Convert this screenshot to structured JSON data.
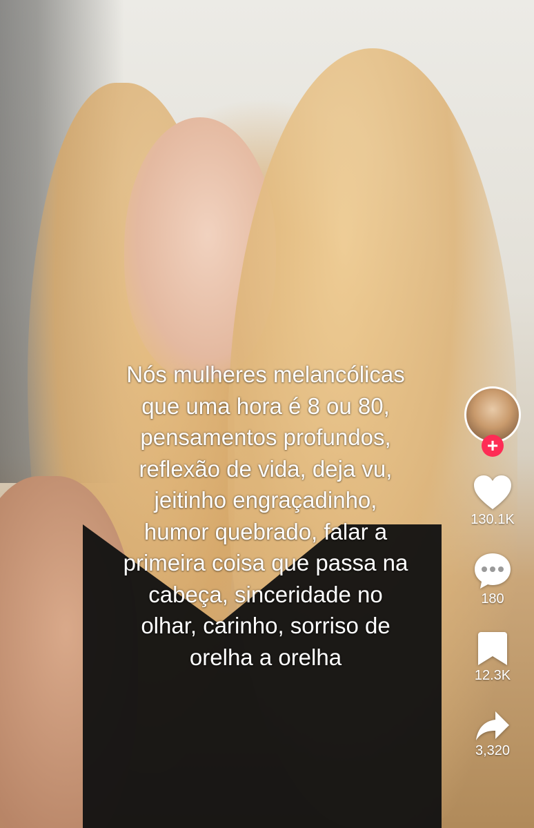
{
  "caption": {
    "lines": [
      "Nós mulheres melancólicas",
      "que uma hora é 8 ou 80,",
      "pensamentos profundos,",
      "reflexão de vida, deja vu,",
      "jeitinho engraçadinho,",
      "humor quebrado, falar a",
      "primeira coisa que passa na",
      "cabeça, sinceridade no",
      "olhar, carinho, sorriso de",
      "orelha a orelha"
    ]
  },
  "sidebar": {
    "follow_symbol": "+",
    "like": {
      "icon": "heart-icon",
      "count": "130.1K"
    },
    "comment": {
      "icon": "comment-icon",
      "count": "180"
    },
    "save": {
      "icon": "bookmark-icon",
      "count": "12.3K"
    },
    "share": {
      "icon": "share-icon",
      "count": "3,320"
    }
  },
  "colors": {
    "follow_accent": "#fe2c55",
    "icon": "#ffffff"
  }
}
